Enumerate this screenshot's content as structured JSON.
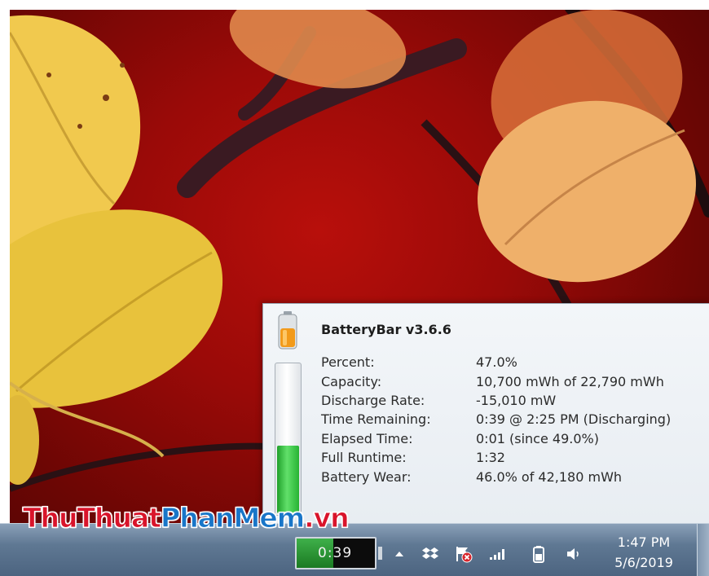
{
  "popup": {
    "title": "BatteryBar v3.6.6",
    "charge_fraction": 0.47,
    "stats": [
      {
        "label": "Percent:",
        "value": "47.0%"
      },
      {
        "label": "Capacity:",
        "value": "10,700 mWh of 22,790 mWh"
      },
      {
        "label": "Discharge Rate:",
        "value": "-15,010 mW"
      },
      {
        "label": "Time Remaining:",
        "value": "0:39 @ 2:25 PM (Discharging)"
      },
      {
        "label": "Elapsed Time:",
        "value": "0:01 (since 49.0%)"
      },
      {
        "label": "Full Runtime:",
        "value": "1:32"
      },
      {
        "label": "Battery Wear:",
        "value": "46.0% of 42,180 mWh"
      }
    ]
  },
  "taskbar": {
    "batterybar_text": "0:39",
    "batterybar_fraction": 0.47,
    "clock_time": "1:47 PM",
    "clock_date": "5/6/2019",
    "tray_icons": [
      "show-hidden-icons",
      "dropbox-icon",
      "action-center-flag-icon",
      "network-signal-icon",
      "battery-icon",
      "volume-icon"
    ]
  },
  "watermark": {
    "part1": "ThuThuat",
    "part2": "PhanMem",
    "part3": ".vn"
  },
  "colors": {
    "gauge_green": "#3fc34a",
    "popup_bg": "#eef2f6",
    "taskbar": "#5f7893",
    "wallpaper_red": "#9a0a08"
  }
}
